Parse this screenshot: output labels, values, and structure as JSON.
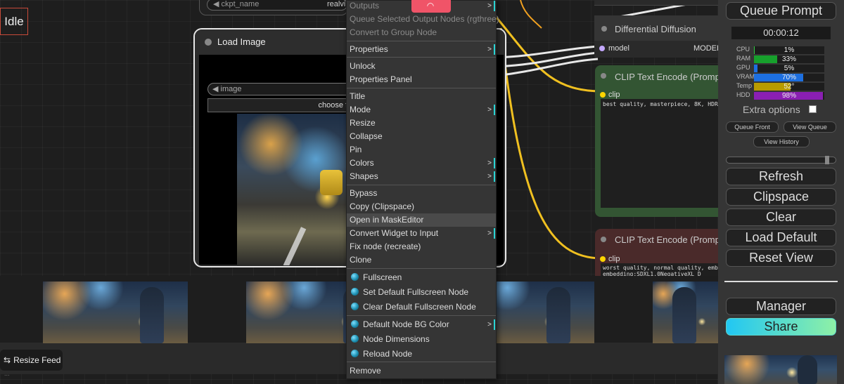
{
  "status": {
    "label": "Idle"
  },
  "ckpt_node": {
    "widget_label": "ckpt_name",
    "widget_value": "realvi"
  },
  "load_image": {
    "title": "Load Image",
    "image_widget_label": "image",
    "choose_file_label": "choose fil"
  },
  "diff_node": {
    "title": "Differential Diffusion",
    "input_label": "model",
    "output_label": "MODEL"
  },
  "clip_positive": {
    "title": "CLIP Text Encode (Promp",
    "input_label": "clip",
    "text": "best quality, masterpiece, 8K, HDR,"
  },
  "clip_negative": {
    "title": "CLIP Text Encode (Promp",
    "input_label": "clip",
    "text_line1": "worst quality, normal quality, embe",
    "text_line2": "embedding:SDXL1.0NegativeXL_D"
  },
  "feed": {
    "resize_label": "Resize Feed",
    "resize_icon": "resize-icon",
    "status_text": "...",
    "thumb_count": 4
  },
  "context_menu": {
    "items": [
      {
        "label": "Outputs",
        "disabled": true,
        "submenu": true
      },
      {
        "label": "Queue Selected Output Nodes (rgthree)",
        "disabled": true
      },
      {
        "label": "Convert to Group Node",
        "disabled": true
      },
      {
        "label": "Properties",
        "submenu": true
      },
      {
        "label": "Unlock"
      },
      {
        "label": "Properties Panel"
      },
      {
        "label": "Title"
      },
      {
        "label": "Mode",
        "submenu": true
      },
      {
        "label": "Resize"
      },
      {
        "label": "Collapse"
      },
      {
        "label": "Pin"
      },
      {
        "label": "Colors",
        "submenu": true
      },
      {
        "label": "Shapes",
        "submenu": true
      },
      {
        "label": "Bypass"
      },
      {
        "label": "Copy (Clipspace)"
      },
      {
        "label": "Open in MaskEditor",
        "highlighted": true
      },
      {
        "label": "Convert Widget to Input",
        "submenu": true
      },
      {
        "label": "Fix node (recreate)"
      },
      {
        "label": "Clone"
      },
      {
        "label": "Fullscreen",
        "icon": "globe-icon"
      },
      {
        "label": "Set Default Fullscreen Node",
        "icon": "globe-icon"
      },
      {
        "label": "Clear Default Fullscreen Node",
        "icon": "globe-icon"
      },
      {
        "label": "Default Node BG Color",
        "icon": "globe-icon",
        "submenu": true
      },
      {
        "label": "Node Dimensions",
        "icon": "globe-icon"
      },
      {
        "label": "Reload Node",
        "icon": "globe-icon"
      },
      {
        "label": "Remove"
      }
    ],
    "arrow_glyph": ">"
  },
  "panel": {
    "queue_prompt_label": "Queue Prompt",
    "timer": "00:00:12",
    "stats": [
      {
        "label": "CPU",
        "value": "1%",
        "fill_pct": 1,
        "color": "#2ecc40"
      },
      {
        "label": "RAM",
        "value": "33%",
        "fill_pct": 33,
        "color": "#17a02c"
      },
      {
        "label": "GPU",
        "value": "5%",
        "fill_pct": 5,
        "color": "#1d6fe0"
      },
      {
        "label": "VRAM",
        "value": "70%",
        "fill_pct": 70,
        "color": "#1d6fe0"
      },
      {
        "label": "Temp",
        "value": "52°",
        "fill_pct": 52,
        "color": "#b89b00"
      },
      {
        "label": "HDD",
        "value": "98%",
        "fill_pct": 98,
        "color": "#8a1fb3"
      }
    ],
    "extra_options_label": "Extra options",
    "queue_front_label": "Queue Front",
    "view_queue_label": "View Queue",
    "view_history_label": "View History",
    "refresh_label": "Refresh",
    "clipspace_label": "Clipspace",
    "clear_label": "Clear",
    "load_default_label": "Load Default",
    "reset_view_label": "Reset View",
    "manager_label": "Manager",
    "share_label": "Share"
  },
  "colors": {
    "wire_yellow": "#f0c020",
    "wire_white": "#e8e8e8",
    "accent_cyan": "#2ad3d3",
    "share_gradient_start": "#21c7f3",
    "share_gradient_end": "#8ef0a6",
    "idle_border": "#c84a3a"
  }
}
